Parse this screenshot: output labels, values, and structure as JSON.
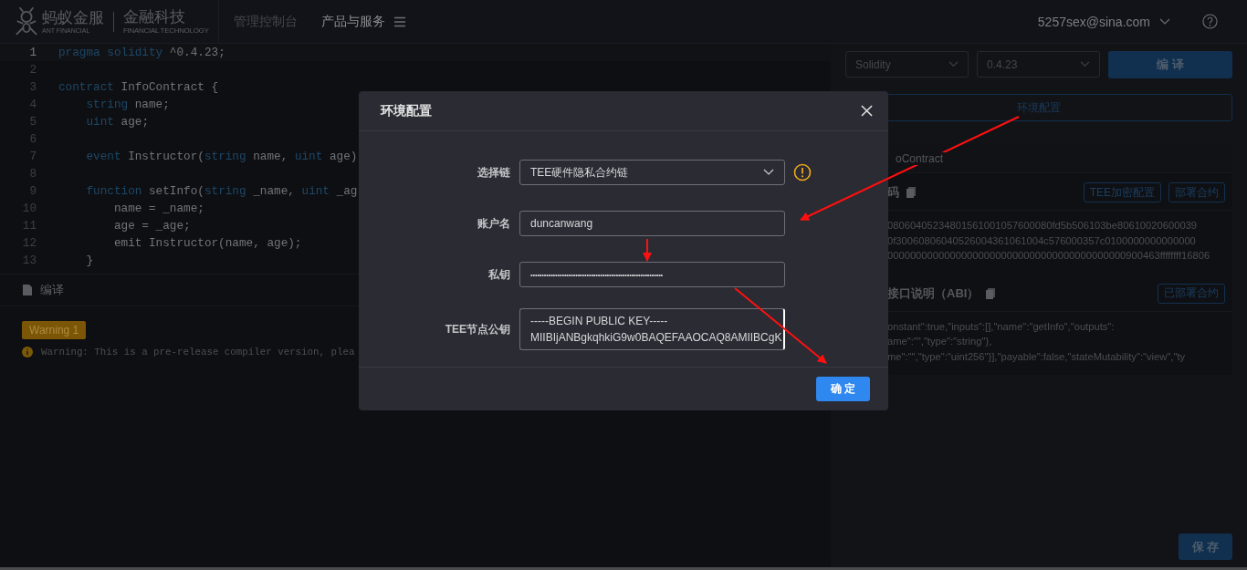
{
  "header": {
    "logo": {
      "brand": "蚂蚁金服",
      "brand_en": "ANT FINANCIAL",
      "product": "金融科技",
      "product_en": "FINANCIAL TECHNOLOGY"
    },
    "nav": [
      {
        "label": "管理控制台",
        "selected": false,
        "menu": false
      },
      {
        "label": "产品与服务",
        "selected": true,
        "menu": true
      }
    ],
    "user": "5257sex@sina.com"
  },
  "editor": {
    "lines": [
      {
        "number": "1",
        "active": true,
        "tokens": [
          {
            "kind": "keyword",
            "text": "pragma solidity"
          },
          {
            "kind": "plain",
            "text": " ^0.4.23;"
          }
        ]
      },
      {
        "number": "2",
        "active": false
      },
      {
        "number": "3",
        "active": false,
        "tokens": [
          {
            "kind": "keyword",
            "text": "contract"
          },
          {
            "kind": "plain",
            "text": " InfoContract {"
          }
        ]
      },
      {
        "number": "4",
        "active": false,
        "tokens": [
          {
            "kind": "keyword",
            "text": "    string"
          },
          {
            "kind": "plain",
            "text": " name;"
          }
        ]
      },
      {
        "number": "5",
        "active": false,
        "tokens": [
          {
            "kind": "keyword",
            "text": "    uint"
          },
          {
            "kind": "plain",
            "text": " age;"
          }
        ]
      },
      {
        "number": "6",
        "active": false
      },
      {
        "number": "7",
        "active": false,
        "tokens": [
          {
            "kind": "keyword",
            "text": "    event"
          },
          {
            "kind": "plain",
            "text": " Instructor("
          },
          {
            "kind": "keyword",
            "text": "string"
          },
          {
            "kind": "plain",
            "text": " name, "
          },
          {
            "kind": "keyword",
            "text": "uint"
          },
          {
            "kind": "plain",
            "text": " age)"
          }
        ]
      },
      {
        "number": "8",
        "active": false
      },
      {
        "number": "9",
        "active": false,
        "tokens": [
          {
            "kind": "keyword",
            "text": "    function"
          },
          {
            "kind": "plain",
            "text": " setInfo("
          },
          {
            "kind": "keyword",
            "text": "string"
          },
          {
            "kind": "plain",
            "text": " _name, "
          },
          {
            "kind": "keyword",
            "text": "uint"
          },
          {
            "kind": "plain",
            "text": " _ag"
          }
        ]
      },
      {
        "number": "10",
        "active": false,
        "tokens": [
          {
            "kind": "plain",
            "text": "        name = _name;"
          }
        ]
      },
      {
        "number": "11",
        "active": false,
        "tokens": [
          {
            "kind": "plain",
            "text": "        age = _age;"
          }
        ]
      },
      {
        "number": "12",
        "active": false,
        "tokens": [
          {
            "kind": "plain",
            "text": "        emit Instructor(name, age);"
          }
        ]
      },
      {
        "number": "13",
        "active": false,
        "tokens": [
          {
            "kind": "plain",
            "text": "    }"
          }
        ]
      }
    ]
  },
  "output": {
    "tab": "编译",
    "badge": "Warning 1",
    "message": "Warning: This is a pre-release compiler version, plea"
  },
  "panel": {
    "language": "Solidity",
    "version": "0.4.23",
    "compile": "编 译",
    "env_button": "环境配置",
    "contract": {
      "name": "oContract",
      "sections": [
        {
          "title": "码",
          "buttons": [
            "TEE加密配置",
            "部署合约"
          ],
          "lines": [
            "08060405234801561001057600080fd5b506103be80610020600039",
            "0f30060806040526004361061004c576000357c0100000000000000",
            "000000000000000000000000000000000000000000900463ffffffff16806"
          ]
        },
        {
          "title": "接口说明（ABI）",
          "buttons": [
            "已部署合约"
          ],
          "lines": [
            "onstant\":true,\"inputs\":[],\"name\":\"getInfo\",\"outputs\":",
            "ame\":\"\",\"type\":\"string\"},",
            "me\":\"\",\"type\":\"uint256\"}],\"payable\":false,\"stateMutability\":\"view\",\"ty"
          ]
        }
      ]
    },
    "save": "保 存"
  },
  "dialog": {
    "title": "环境配置",
    "fields": [
      {
        "kind": "select",
        "label": "选择链",
        "value": "TEE硬件隐私合约链",
        "warning": true
      },
      {
        "kind": "text",
        "label": "账户名",
        "value": "duncanwang"
      },
      {
        "kind": "password",
        "label": "私钥",
        "value": "•••••••••••••••••••••••••••••••••••••••••••••••••••••••••••"
      },
      {
        "kind": "textarea",
        "label": "TEE节点公钥",
        "lines": [
          "-----BEGIN PUBLIC KEY-----",
          "MIIBIjANBgkqhkiG9w0BAQEFAAOCAQ8AMIIBCgK"
        ]
      }
    ],
    "confirm": "确 定"
  }
}
